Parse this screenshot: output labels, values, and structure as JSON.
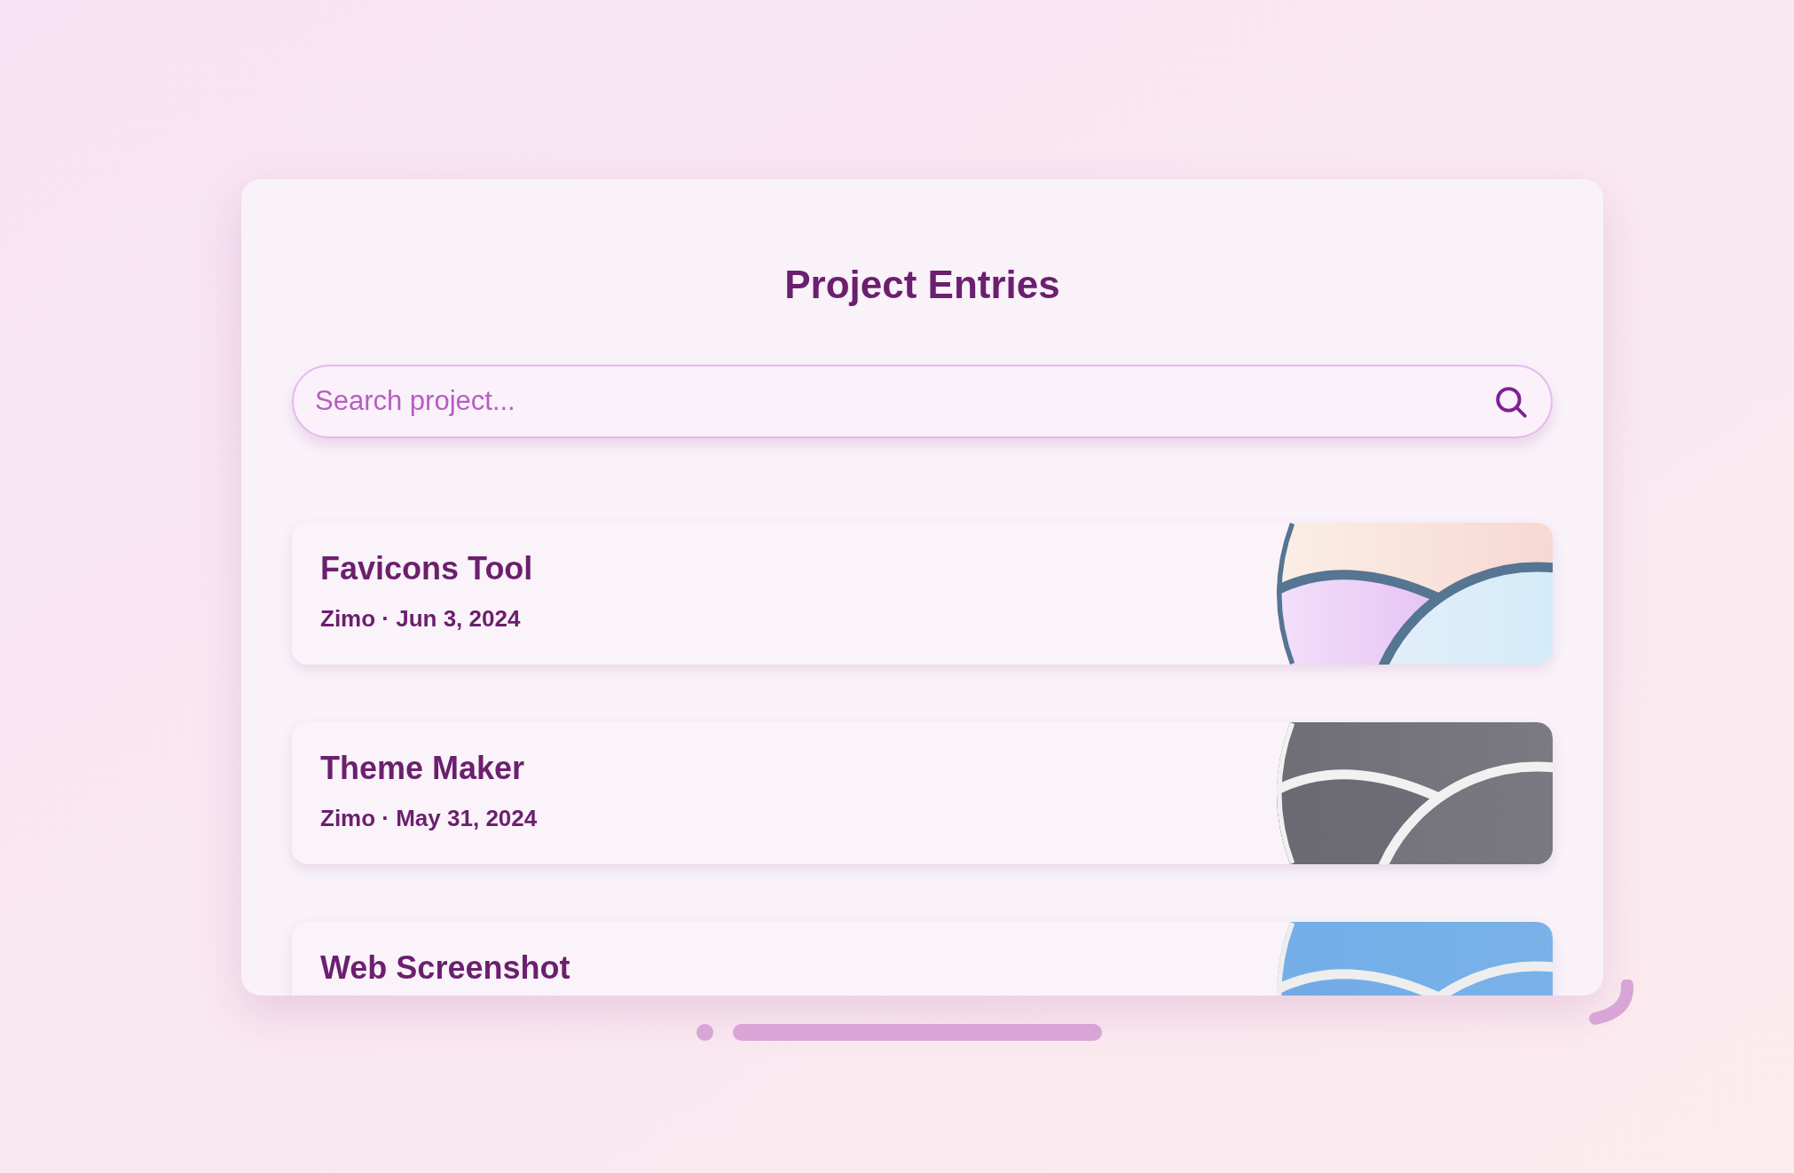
{
  "title": "Project Entries",
  "search": {
    "placeholder": "Search project..."
  },
  "entries": [
    {
      "title": "Favicons Tool",
      "meta": "Zimo · Jun 3, 2024",
      "kind": "pastel"
    },
    {
      "title": "Theme Maker",
      "meta": "Zimo · May 31, 2024",
      "kind": "gray"
    },
    {
      "title": "Web Screenshot",
      "kind": "blue"
    }
  ]
}
